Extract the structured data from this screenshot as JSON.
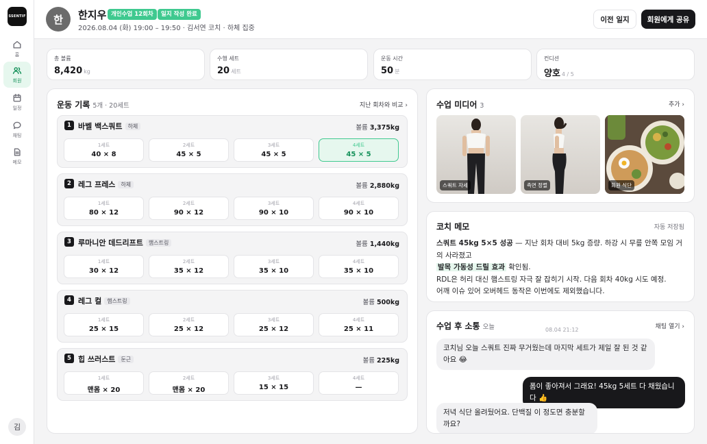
{
  "rail": {
    "logo": "SSENTIF",
    "items": [
      {
        "label": "홈"
      },
      {
        "label": "회원"
      },
      {
        "label": "일정"
      },
      {
        "label": "채팅"
      },
      {
        "label": "메모"
      }
    ],
    "me_initial": "김"
  },
  "header": {
    "avatar": "한",
    "name": "한지우",
    "badge_session": "개인수업 12회차",
    "badge_status": "일지 작성 완료",
    "subtitle": "2026.08.04 (화) 19:00 – 19:50 · 김서연 코치 · 하체 집중",
    "prev_button": "이전 일지",
    "share_button": "회원에게 공유"
  },
  "stats": [
    {
      "label": "총 볼륨",
      "value": "8,420",
      "unit": "kg"
    },
    {
      "label": "수행 세트",
      "value": "20",
      "unit": "세트"
    },
    {
      "label": "운동 시간",
      "value": "50",
      "unit": "분"
    },
    {
      "label": "컨디션",
      "value": "양호",
      "unit": "4 / 5"
    }
  ],
  "workout": {
    "title": "운동 기록",
    "summary": "5개 · 20세트",
    "compare_link": "지난 회차와 비교 ›",
    "volume_label": "볼륨",
    "exercises": [
      {
        "num": "1",
        "name": "바벨 백스쿼트",
        "tag": "하체",
        "volume": "3,375kg",
        "sets": [
          {
            "label": "1세트",
            "value": "40 × 8"
          },
          {
            "label": "2세트",
            "value": "45 × 5"
          },
          {
            "label": "3세트",
            "value": "45 × 5"
          },
          {
            "label": "4세트",
            "value": "45 × 5"
          }
        ]
      },
      {
        "num": "2",
        "name": "레그 프레스",
        "tag": "하체",
        "volume": "2,880kg",
        "sets": [
          {
            "label": "1세트",
            "value": "80 × 12"
          },
          {
            "label": "2세트",
            "value": "90 × 12"
          },
          {
            "label": "3세트",
            "value": "90 × 10"
          },
          {
            "label": "4세트",
            "value": "90 × 10"
          }
        ]
      },
      {
        "num": "3",
        "name": "루마니안 데드리프트",
        "tag": "햄스트링",
        "volume": "1,440kg",
        "sets": [
          {
            "label": "1세트",
            "value": "30 × 12"
          },
          {
            "label": "2세트",
            "value": "35 × 12"
          },
          {
            "label": "3세트",
            "value": "35 × 10"
          },
          {
            "label": "4세트",
            "value": "35 × 10"
          }
        ]
      },
      {
        "num": "4",
        "name": "레그 컬",
        "tag": "햄스트링",
        "volume": "500kg",
        "sets": [
          {
            "label": "1세트",
            "value": "25 × 15"
          },
          {
            "label": "2세트",
            "value": "25 × 12"
          },
          {
            "label": "3세트",
            "value": "25 × 12"
          },
          {
            "label": "4세트",
            "value": "25 × 11"
          }
        ]
      },
      {
        "num": "5",
        "name": "힙 쓰러스트",
        "tag": "둔근",
        "volume": "225kg",
        "sets": [
          {
            "label": "1세트",
            "value": "맨몸 × 20"
          },
          {
            "label": "2세트",
            "value": "맨몸 × 20"
          },
          {
            "label": "3세트",
            "value": "15 × 15"
          },
          {
            "label": "4세트",
            "value": "—"
          }
        ]
      }
    ]
  },
  "media": {
    "title": "수업 미디어",
    "count": "3",
    "add_link": "추가 ›",
    "items": [
      {
        "label": "스쿼트 자세"
      },
      {
        "label": "측면 정렬"
      },
      {
        "label": "회원 식단"
      }
    ]
  },
  "memo": {
    "title": "코치 메모",
    "autosave": "자동 저장됨",
    "line1_bold": "스쿼트 45kg 5×5 성공",
    "line1_rest": " — 지난 회차 대비 5kg 증량. 하강 시 무릎 안쪽 모임 거의 사라졌고",
    "line2_highlight": "발목 가동성 드릴 효과",
    "line2_rest": " 확인됨.",
    "line3": "RDL은 허리 대신 햄스트링 자극 잘 잡히기 시작. 다음 회차 40kg 시도 예정.",
    "line4": "어깨 이슈 있어 오버헤드 동작은 이번에도 제외했습니다."
  },
  "chat": {
    "title": "수업 후 소통",
    "when": "오늘",
    "open_link": "채팅 열기 ›",
    "timestamp": "08.04 21:12",
    "messages": [
      {
        "from": "member",
        "text": "코치님 오늘 스쿼트 진짜 무거웠는데 마지막 세트가 제일 잘 된 것 같아요 😂"
      },
      {
        "from": "coach",
        "text": "폼이 좋아져서 그래요! 45kg 5세트 다 채웠습니다 👍"
      },
      {
        "from": "member",
        "text": "저녁 식단 올려뒀어요. 단백질 이 정도면 충분할까요?"
      }
    ]
  }
}
